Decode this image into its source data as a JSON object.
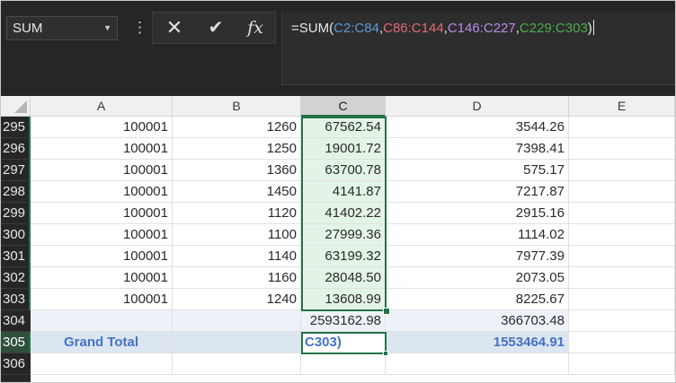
{
  "name_box": "SUM",
  "formula": {
    "prefix": "=SUM(",
    "range1": "C2:C84",
    "sep1": ",",
    "range2": "C86:C144",
    "sep2": ",",
    "range3": "C146:C227",
    "sep3": ",",
    "range4": "C229:C303",
    "suffix": ")"
  },
  "range_colors": [
    "#5b9bd5",
    "#e06c75",
    "#b48ee8",
    "#4caf50"
  ],
  "columns": [
    "A",
    "B",
    "C",
    "D",
    "E"
  ],
  "selected_column": "C",
  "rows": [
    {
      "num": "295",
      "a": "100001",
      "b": "1260",
      "c": "67562.54",
      "d": "3544.26"
    },
    {
      "num": "296",
      "a": "100001",
      "b": "1250",
      "c": "19001.72",
      "d": "7398.41"
    },
    {
      "num": "297",
      "a": "100001",
      "b": "1360",
      "c": "63700.78",
      "d": "575.17"
    },
    {
      "num": "298",
      "a": "100001",
      "b": "1450",
      "c": "4141.87",
      "d": "7217.87"
    },
    {
      "num": "299",
      "a": "100001",
      "b": "1120",
      "c": "41402.22",
      "d": "2915.16"
    },
    {
      "num": "300",
      "a": "100001",
      "b": "1100",
      "c": "27999.36",
      "d": "1114.02"
    },
    {
      "num": "301",
      "a": "100001",
      "b": "1140",
      "c": "63199.32",
      "d": "7977.39"
    },
    {
      "num": "302",
      "a": "100001",
      "b": "1160",
      "c": "28048.50",
      "d": "2073.05"
    },
    {
      "num": "303",
      "a": "100001",
      "b": "1240",
      "c": "13608.99",
      "d": "8225.67"
    }
  ],
  "subtotal_row": {
    "num": "304",
    "c": "2593162.98",
    "d": "366703.48"
  },
  "grand_total_row": {
    "num": "305",
    "label": "Grand Total",
    "c_editing": "C303)",
    "d": "1553464.91"
  },
  "empty_row": {
    "num": "306"
  },
  "accent_color": "#217346"
}
